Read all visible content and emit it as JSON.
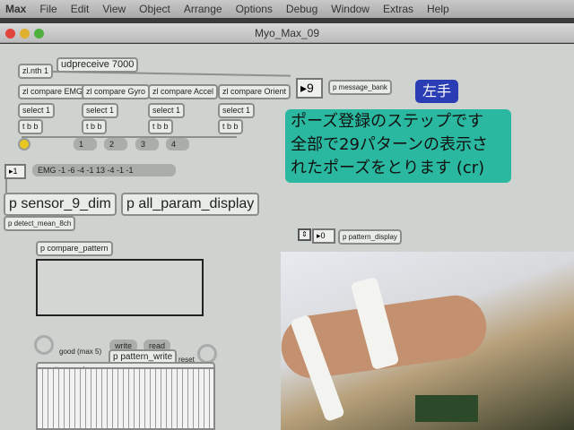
{
  "menu": [
    "Max",
    "File",
    "Edit",
    "View",
    "Object",
    "Arrange",
    "Options",
    "Debug",
    "Window",
    "Extras",
    "Help"
  ],
  "window_title": "Myo_Max_09",
  "objects": {
    "zlnth": "zl.nth 1",
    "udp": "udpreceive 7000",
    "compare": [
      "zl compare EMG",
      "zl compare Gyro",
      "zl compare Accel",
      "zl compare Orient"
    ],
    "select": "select 1",
    "tbb": "t b b",
    "messages": [
      "1",
      "2",
      "3",
      "4"
    ],
    "number_in": "1",
    "emg_msg": "EMG -1 -6 -4 -1 13 -4 -1 -1",
    "sensor": "p sensor_9_dim",
    "all_param": "p all_param_display",
    "detect": "p detect_mean_8ch",
    "compare_pattern": "p compare_pattern",
    "good": "good (max 5)",
    "write": "write",
    "read": "read",
    "pattern_write": "p pattern_write",
    "reset": "reset",
    "pattern_rank": "p pattern_rank",
    "bank_number": "9",
    "message_bank": "p message_bank",
    "hand_button": "左手",
    "note": [
      "ポーズ登録のステップです",
      "全部で29パターンの表示さ",
      "れたポーズをとります (cr)"
    ],
    "display_number": "0",
    "pattern_display": "p pattern_display"
  }
}
